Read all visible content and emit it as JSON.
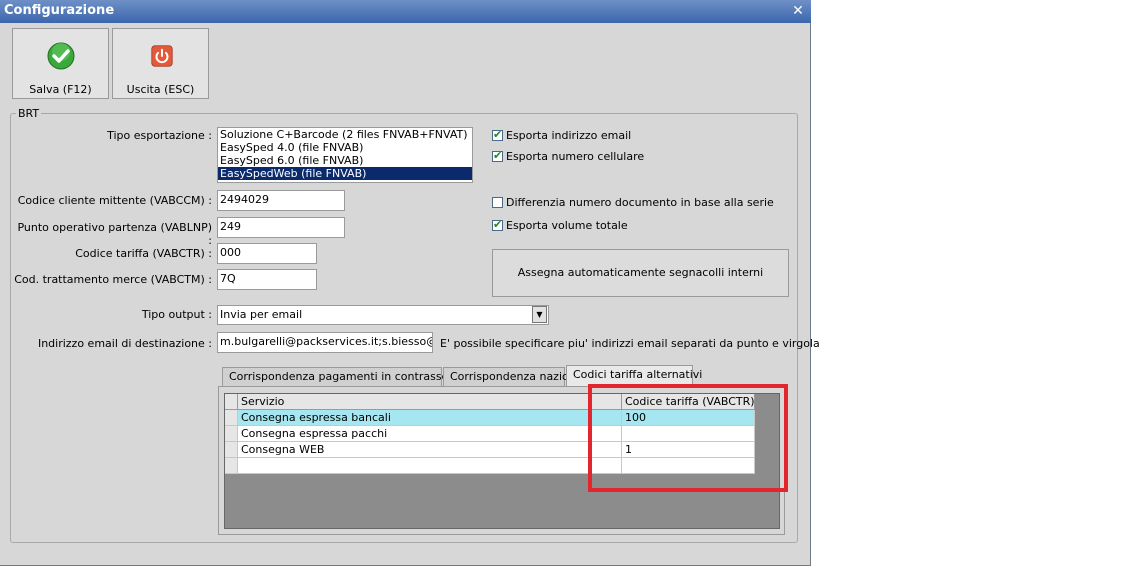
{
  "window": {
    "title": "Configurazione",
    "close_icon": "close-icon"
  },
  "toolbar": {
    "save": {
      "label": "Salva (F12)",
      "icon": "green-check-icon"
    },
    "exit": {
      "label": "Uscita (ESC)",
      "icon": "power-icon"
    }
  },
  "group": {
    "title": "BRT"
  },
  "form": {
    "tipo_esportazione": {
      "label": "Tipo esportazione :",
      "options": [
        "Soluzione C+Barcode (2 files FNVAB+FNVAT)",
        "EasySped 4.0 (file FNVAB)",
        "EasySped 6.0 (file FNVAB)",
        "EasySpedWeb (file FNVAB)"
      ],
      "selected_index": 3
    },
    "codice_cliente": {
      "label": "Codice cliente mittente (VABCCM) :",
      "value": "2494029"
    },
    "punto_operativo": {
      "label": "Punto operativo partenza (VABLNP) :",
      "value": "249"
    },
    "codice_tariffa": {
      "label": "Codice tariffa (VABCTR) :",
      "value": "000"
    },
    "cod_trattamento": {
      "label": "Cod. trattamento merce (VABCTM) :",
      "value": "7Q"
    },
    "tipo_output": {
      "label": "Tipo output :",
      "value": "Invia per email"
    },
    "email_dest": {
      "label": "Indirizzo email di destinazione :",
      "value": "m.bulgarelli@packservices.it;s.biesso@packs",
      "hint": "E' possibile specificare piu' indirizzi email separati da punto e virgola"
    }
  },
  "checkboxes": [
    {
      "label": "Esporta indirizzo email",
      "checked": true
    },
    {
      "label": "Esporta numero cellulare",
      "checked": true
    },
    {
      "label": "Differenzia numero documento in base alla serie",
      "checked": false
    },
    {
      "label": "Esporta volume totale",
      "checked": true
    }
  ],
  "assign_button": {
    "label": "Assegna automaticamente segnacolli interni"
  },
  "tabs": [
    {
      "label": "Corrispondenza pagamenti in contrassegno",
      "active": false
    },
    {
      "label": "Corrispondenza nazioni",
      "active": false
    },
    {
      "label": "Codici tariffa alternativi",
      "active": true
    }
  ],
  "grid": {
    "columns": [
      "Servizio",
      "Codice tariffa (VABCTR)"
    ],
    "rows": [
      [
        "Consegna espressa bancali",
        "100"
      ],
      [
        "Consegna espressa pacchi",
        ""
      ],
      [
        "Consegna WEB",
        "1"
      ],
      [
        "",
        ""
      ]
    ],
    "highlight_color": "#e3262e",
    "selected_row_color": "#a6e6f0"
  }
}
